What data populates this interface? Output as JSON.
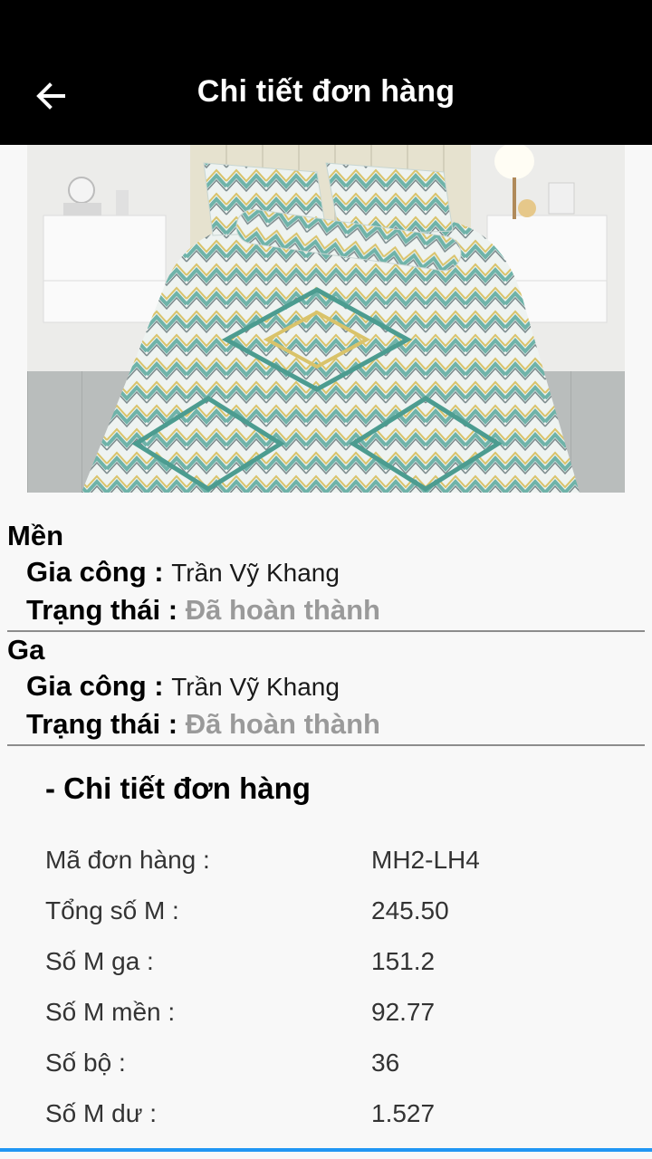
{
  "appbar": {
    "title": "Chi tiết đơn hàng",
    "back_icon": "arrow-left-icon"
  },
  "hero_image": {
    "subject": "bedding set photo"
  },
  "production_items": [
    {
      "type": "Mền",
      "worker_label": "Gia công :",
      "worker_value": "Trần Vỹ Khang",
      "status_label": "Trạng thái :",
      "status_value": "Đã hoàn thành"
    },
    {
      "type": "Ga",
      "worker_label": "Gia công :",
      "worker_value": "Trần Vỹ Khang",
      "status_label": "Trạng thái :",
      "status_value": "Đã hoàn thành"
    }
  ],
  "order_detail": {
    "title": "- Chi tiết đơn hàng",
    "rows": [
      {
        "label": "Mã đơn hàng :",
        "value": "MH2-LH4"
      },
      {
        "label": "Tổng số M :",
        "value": "245.50"
      },
      {
        "label": "Số M ga :",
        "value": "151.2"
      },
      {
        "label": "Số M mền :",
        "value": "92.77"
      },
      {
        "label": "Số bộ :",
        "value": "36"
      },
      {
        "label": "Số M dư :",
        "value": "1.527"
      }
    ]
  },
  "colors": {
    "appbar_bg": "#000000",
    "status_text": "#9a9a9a",
    "accent_line": "#2196f3"
  }
}
